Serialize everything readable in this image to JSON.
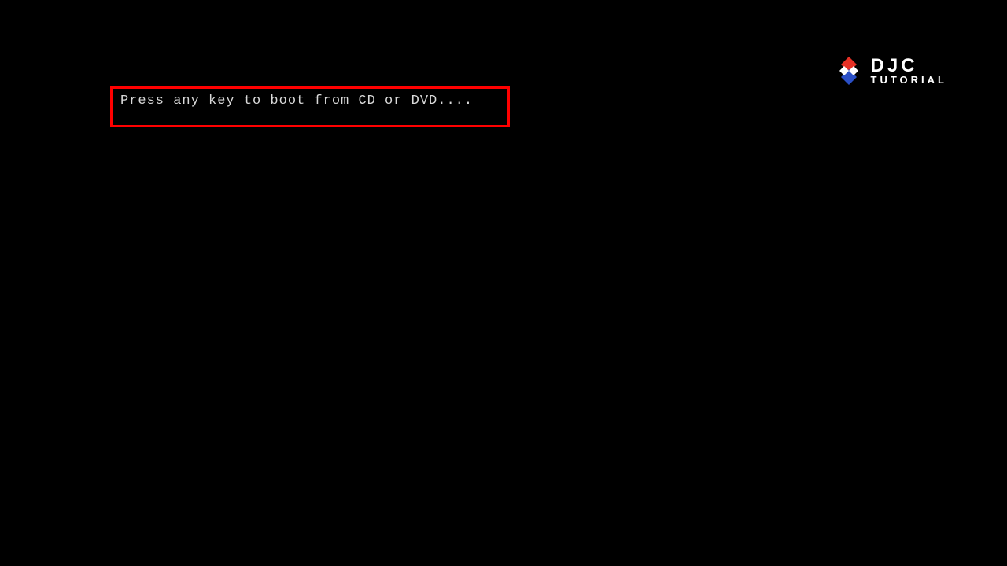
{
  "boot": {
    "prompt": "Press any key to boot from CD or DVD...."
  },
  "logo": {
    "main": "DJC",
    "sub": "TUTORIAL"
  },
  "colors": {
    "highlight_border": "#ff0000",
    "text": "#d9d9d9",
    "logo_red": "#e53025",
    "logo_blue": "#2a4fc6",
    "logo_white": "#ffffff"
  }
}
